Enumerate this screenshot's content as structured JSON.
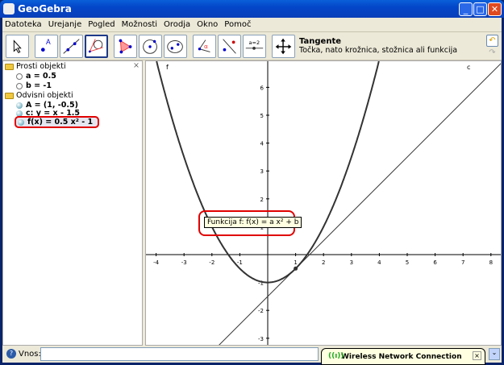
{
  "window": {
    "title": "GeoGebra"
  },
  "menu": [
    "Datoteka",
    "Urejanje",
    "Pogled",
    "Možnosti",
    "Orodja",
    "Okno",
    "Pomoč"
  ],
  "tool_info": {
    "name": "Tangente",
    "description": "Točka, nato krožnica, stožnica ali funkcija"
  },
  "algebra": {
    "free_folder": "Prosti objekti",
    "free": [
      "a = 0.5",
      "b = -1"
    ],
    "dep_folder": "Odvisni objekti",
    "dep": [
      "A = (1, -0.5)",
      "c: y = x - 1.5",
      "f(x) = 0.5 x² - 1"
    ]
  },
  "graph": {
    "x_ticks": [
      -4,
      -3,
      -2,
      -1,
      1,
      2,
      3,
      4,
      5,
      6,
      7,
      8
    ],
    "y_ticks": [
      6,
      5,
      4,
      3,
      2,
      1,
      -1,
      -2,
      -3
    ],
    "labels": {
      "f": "f",
      "c": "c"
    },
    "tooltip": "Funkcija f: f(x) = a x² + b",
    "point_A": [
      1,
      -0.5
    ],
    "a": 0.5,
    "b": -1,
    "colors": {
      "highlight": "#e00000",
      "axis": "#000000"
    }
  },
  "input": {
    "label": "Vnos:",
    "value": ""
  },
  "notification": {
    "text": "Wireless Network Connection"
  }
}
